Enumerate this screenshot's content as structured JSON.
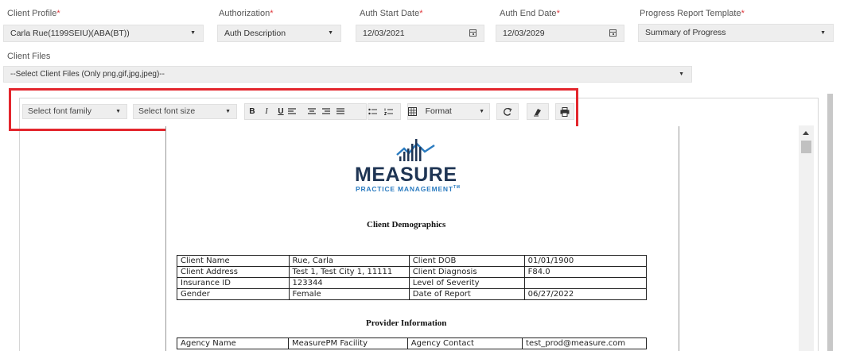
{
  "form": {
    "client_profile": {
      "label": "Client Profile",
      "required_mark": "*",
      "value": "Carla Rue(1199SEIU)(ABA(BT))"
    },
    "authorization": {
      "label": "Authorization",
      "required_mark": "*",
      "value": "Auth Description"
    },
    "auth_start": {
      "label": "Auth Start Date",
      "required_mark": "*",
      "value": "12/03/2021"
    },
    "auth_end": {
      "label": "Auth End Date",
      "required_mark": "*",
      "value": "12/03/2029"
    },
    "template": {
      "label": "Progress Report Template",
      "required_mark": "*",
      "value": "Summary of Progress"
    },
    "client_files": {
      "label": "Client Files",
      "value": "--Select Client Files (Only png,gif,jpg,jpeg)--"
    }
  },
  "toolbar": {
    "font_family": "Select font family",
    "font_size": "Select font size",
    "bold": "B",
    "italic": "I",
    "underline": "U",
    "format": "Format"
  },
  "logo": {
    "word": "MEASURE",
    "tagline": "PRACTICE MANAGEMENT",
    "tm": "TM"
  },
  "document": {
    "demographics_title": "Client Demographics",
    "demographics_rows": [
      [
        "Client Name",
        "Rue, Carla",
        "Client DOB",
        "01/01/1900"
      ],
      [
        "Client Address",
        "Test 1, Test City 1, 11111",
        "Client Diagnosis",
        "F84.0"
      ],
      [
        "Insurance ID",
        "123344",
        "Level of Severity",
        ""
      ],
      [
        "Gender",
        "Female",
        "Date of Report",
        "06/27/2022"
      ]
    ],
    "provider_title": "Provider Information",
    "provider_rows": [
      [
        "Agency Name",
        "MeasurePM Facility",
        "Agency Contact",
        "test_prod@measure.com"
      ]
    ]
  },
  "colors": {
    "highlight": "#e3262d",
    "logo_navy": "#1f3554",
    "logo_blue": "#2a7bc0"
  }
}
